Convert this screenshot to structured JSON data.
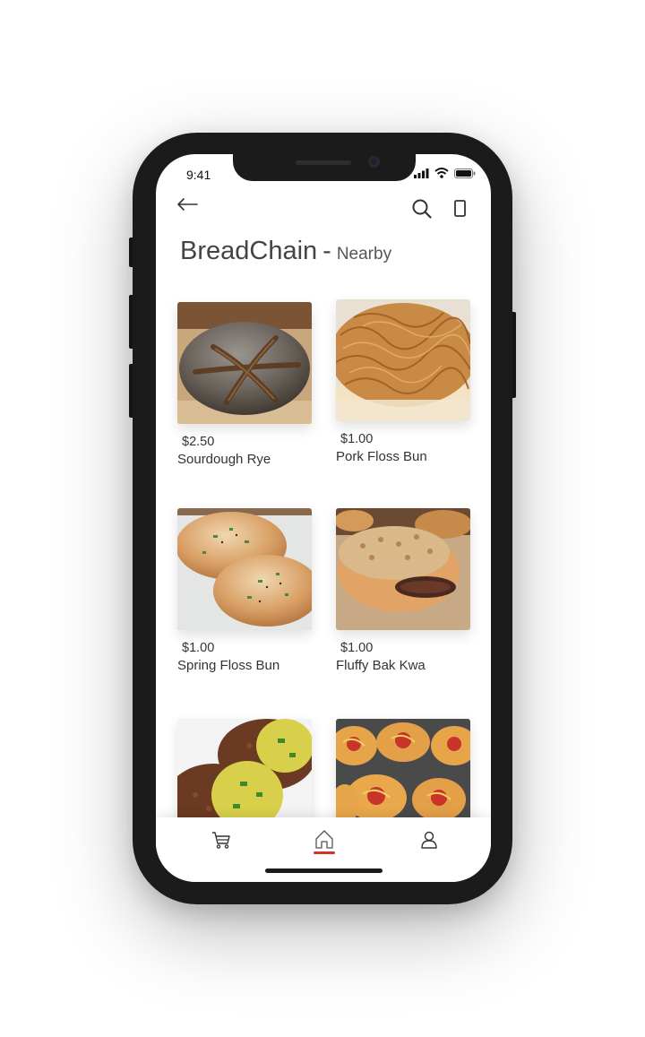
{
  "status_bar": {
    "time": "9:41"
  },
  "header": {
    "title": "BreadChain",
    "separator": "-",
    "subtitle": "Nearby"
  },
  "icons": {
    "back": "back-arrow-icon",
    "search": "search-icon",
    "device": "phone-icon"
  },
  "products": [
    {
      "price": "$2.50",
      "name": "Sourdough Rye"
    },
    {
      "price": "$1.00",
      "name": "Pork Floss Bun"
    },
    {
      "price": "$1.00",
      "name": "Spring Floss Bun"
    },
    {
      "price": "$1.00",
      "name": "Fluffy Bak Kwa"
    },
    {
      "price": "",
      "name": ""
    },
    {
      "price": "",
      "name": ""
    }
  ],
  "tabbar": {
    "items": [
      "cart-icon",
      "home-icon",
      "profile-icon"
    ],
    "active": "home-icon",
    "accent_color": "#d0342c"
  }
}
